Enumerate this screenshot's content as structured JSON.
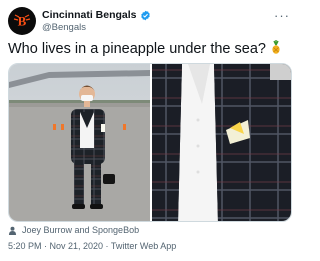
{
  "author": {
    "display_name": "Cincinnati Bengals",
    "handle": "@Bengals",
    "verified": true,
    "avatar_icon": "bengals-logo-icon",
    "brand_color": "#fb4f14"
  },
  "tweet": {
    "text": "Who lives in a pineapple under the sea?",
    "emoji_icon": "pineapple-icon",
    "tagged_people": "Joey Burrow and SpongeBob",
    "timestamp": "5:20 PM · Nov 21, 2020 · Twitter Web App"
  },
  "menu": {
    "icon": "more-icon",
    "label": "···"
  },
  "media": {
    "photo_count": 2,
    "photos": [
      {
        "name": "photo-walking-on-tarmac"
      },
      {
        "name": "photo-suit-closeup-pocket-square"
      }
    ]
  },
  "colors": {
    "verified": "#1d9bf0",
    "secondary_text": "#536471"
  }
}
